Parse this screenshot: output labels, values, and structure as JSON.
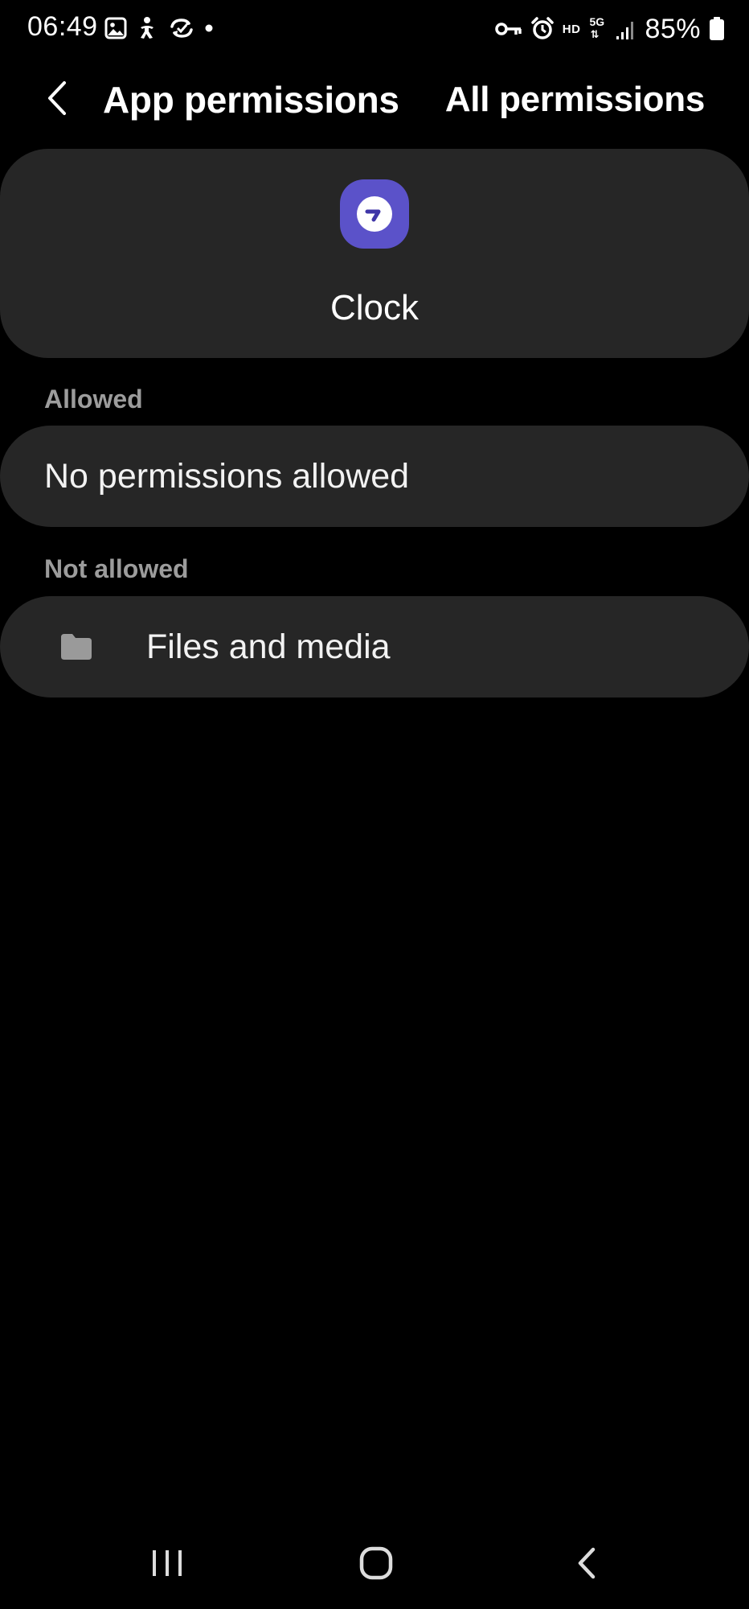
{
  "status_bar": {
    "time": "06:49",
    "left_icons": [
      "gallery-icon",
      "person-icon",
      "sync-icon",
      "dot-icon"
    ],
    "right_icons": [
      "vpn-key-icon",
      "alarm-icon",
      "hd-icon",
      "5g-icon",
      "signal-icon",
      "battery-icon"
    ],
    "hd_label": "HD",
    "network_label": "5G",
    "battery_percent": "85%"
  },
  "header": {
    "title": "App permissions",
    "action_label": "All permissions"
  },
  "app": {
    "name": "Clock",
    "icon": "clock-app-icon",
    "icon_color": "#5b52c9"
  },
  "sections": {
    "allowed": {
      "label": "Allowed",
      "empty_text": "No permissions allowed"
    },
    "not_allowed": {
      "label": "Not allowed",
      "items": [
        {
          "label": "Files and media",
          "icon": "folder-icon"
        }
      ]
    }
  },
  "nav_bar": {
    "buttons": [
      "recent-apps-icon",
      "home-icon",
      "back-icon"
    ]
  },
  "colors": {
    "background": "#000000",
    "card": "#262626",
    "section_label": "#9c9c9c",
    "text": "#ffffff",
    "folder_icon": "#9a9a9a"
  }
}
